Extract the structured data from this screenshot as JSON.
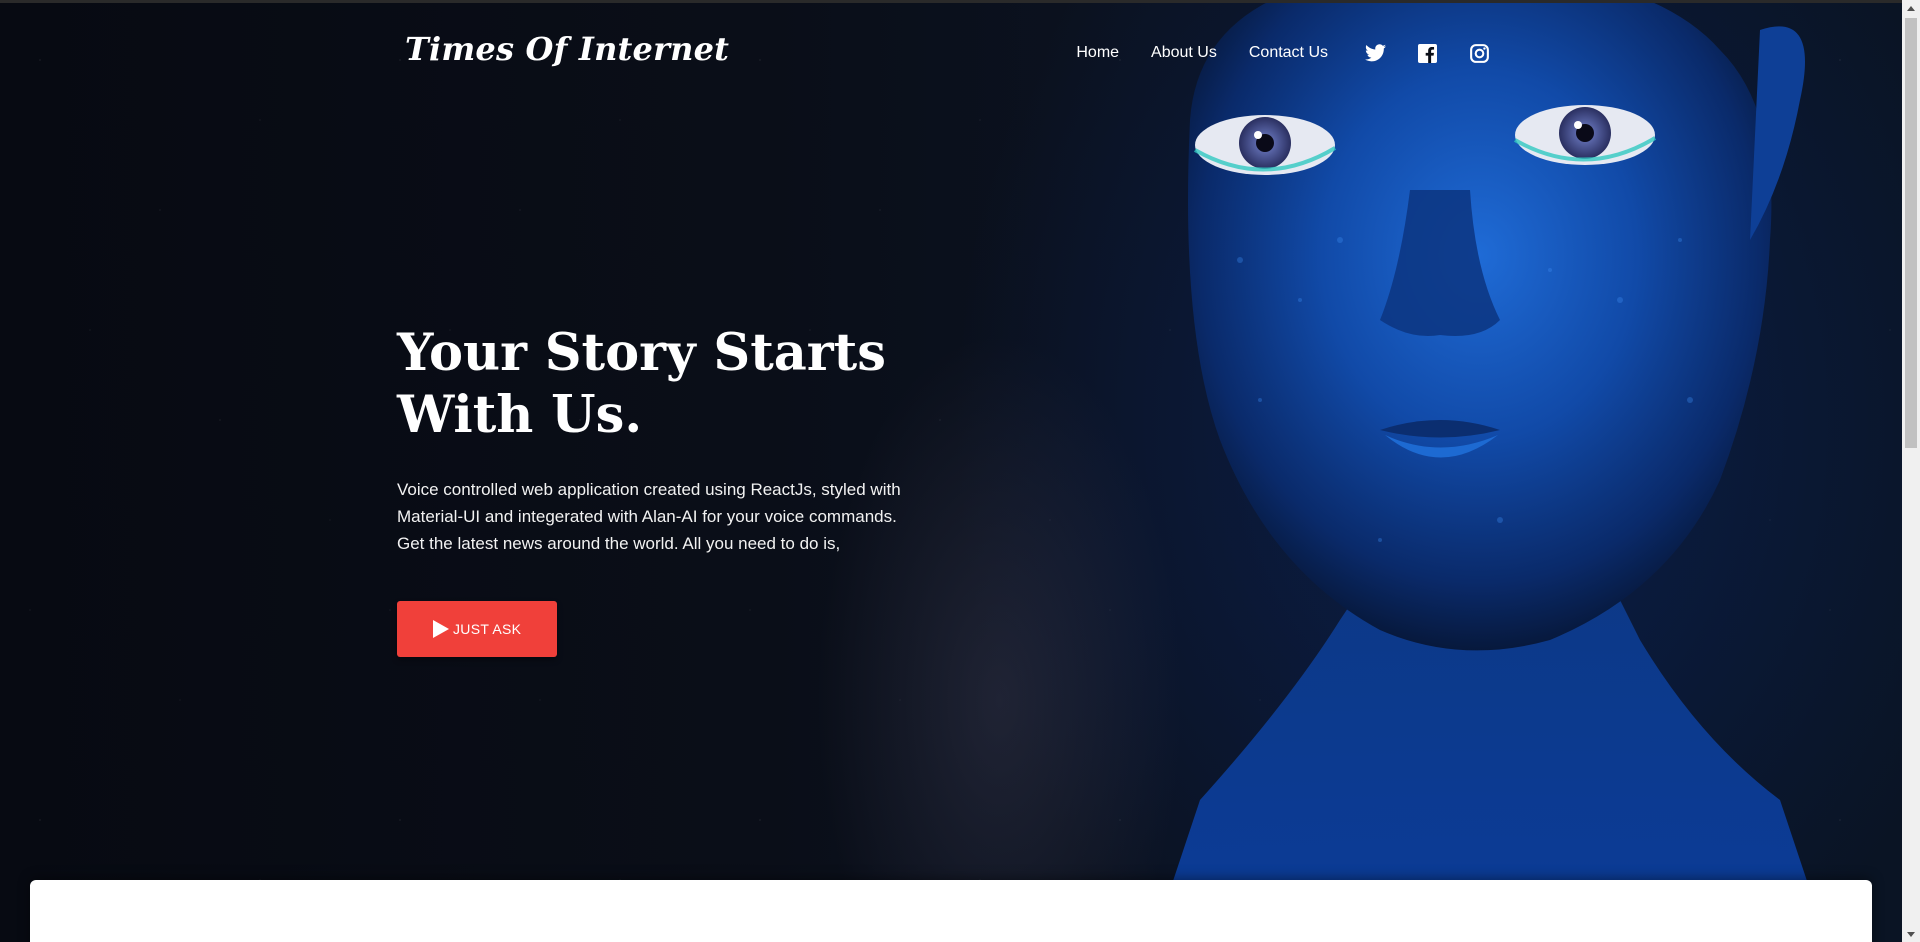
{
  "brand": {
    "name": "Times Of Internet"
  },
  "nav": {
    "links": [
      {
        "label": "Home"
      },
      {
        "label": "About Us"
      },
      {
        "label": "Contact Us"
      }
    ],
    "social_icons": [
      "twitter-icon",
      "facebook-icon",
      "instagram-icon"
    ]
  },
  "hero": {
    "title_line1": "Your Story Starts",
    "title_line2": "With Us.",
    "description_line1": "Voice controlled web application created using ReactJs, styled with",
    "description_line2": "Material-UI and integerated with Alan-AI for your voice commands.",
    "description_line3": "Get the latest news around the world. All you need to do is,",
    "button_label": "JUST ASK",
    "button_icon": "play-icon"
  },
  "colors": {
    "accent": "#f0403a",
    "background": "#0b0d14",
    "text": "#ffffff",
    "card": "#ffffff"
  }
}
